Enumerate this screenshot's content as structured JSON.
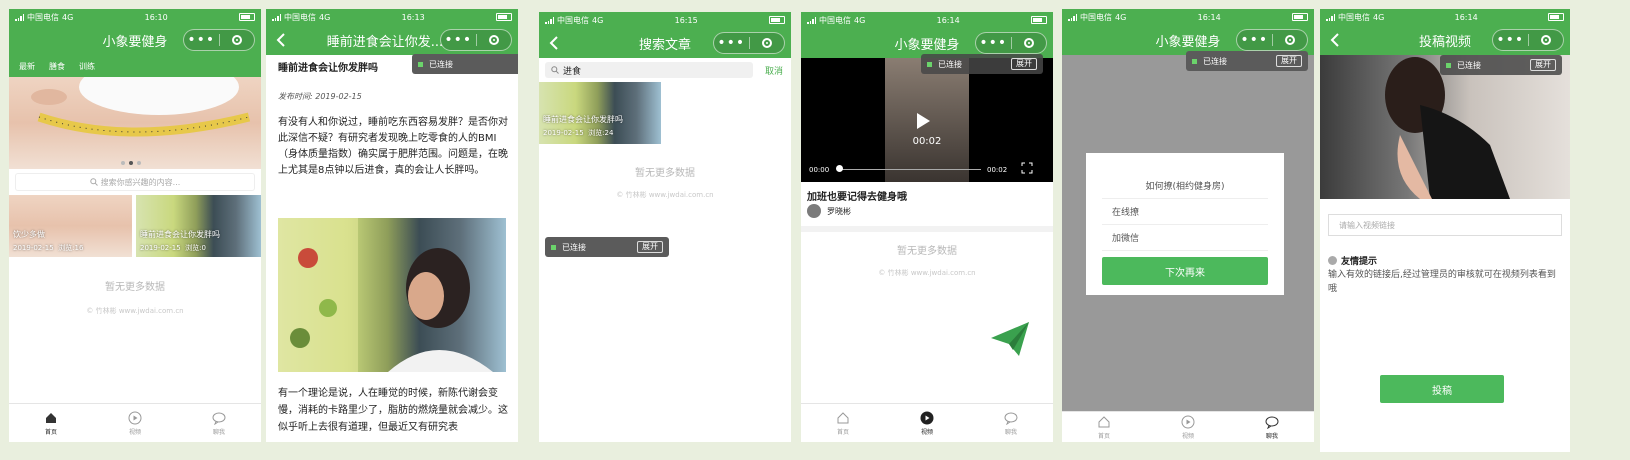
{
  "status": {
    "carrier": "中国电信",
    "network": "4G"
  },
  "connect": {
    "label": "已连接",
    "expand": "展开"
  },
  "tabs": {
    "home": "首页",
    "video": "视频",
    "message": "聊我"
  },
  "empty_text": "暂无更多数据",
  "copyright": "© 竹林彬 www.jwdai.com.cn",
  "colors": {
    "brand": "#4caf50",
    "button": "#4cb95c"
  },
  "screen1": {
    "time": "16:10",
    "title": "小象要健身",
    "categories": [
      "最新",
      "膳食",
      "训练"
    ],
    "search_placeholder": "搜索你感兴趣的内容...",
    "card1": {
      "title": "饮少多做",
      "date": "2019-02-15",
      "views": "浏览:16"
    },
    "card2": {
      "title": "睡前进食会让你发胖吗",
      "date": "2019-02-15",
      "views": "浏览:0"
    }
  },
  "screen2": {
    "time": "16:13",
    "title": "睡前进食会让你发...",
    "article_title": "睡前进食会让你发胖吗",
    "publish": "发布时间: 2019-02-15",
    "para1": "有没有人和你说过，睡前吃东西容易发胖？是否你对此深信不疑？有研究者发现晚上吃零食的人的BMI（身体质量指数）确实属于肥胖范围。问题是，在晚上尤其是8点钟以后进食，真的会让人长胖吗。",
    "para2": "有一个理论是说，人在睡觉的时候，新陈代谢会变慢，消耗的卡路里少了，脂肪的燃烧量就会减少。这似乎听上去很有道理，但最近又有研究表"
  },
  "screen3": {
    "time": "16:15",
    "title": "搜索文章",
    "search_value": "进食",
    "cancel": "取消",
    "result": {
      "title": "睡前进食会让你发胖吗",
      "date": "2019-02-15",
      "views": "浏览:24"
    }
  },
  "screen4": {
    "time": "16:14",
    "title": "小象要健身",
    "play_time": "00:02",
    "current": "00:00",
    "duration": "00:02",
    "video_title": "加班也要记得去健身哦",
    "author": "罗晓彬"
  },
  "screen5": {
    "time": "16:14",
    "title": "小象要健身",
    "dialog_title": "如何撩(相约健身房)",
    "option1": "在线撩",
    "option2": "加微信",
    "button": "下次再来"
  },
  "screen6": {
    "time": "16:14",
    "title": "投稿视频",
    "input_placeholder": "请输入视频链接",
    "tip_title": "友情提示",
    "tip_text": "输入有效的链接后,经过管理员的审核就可在视频列表看到哦",
    "submit": "投稿"
  }
}
